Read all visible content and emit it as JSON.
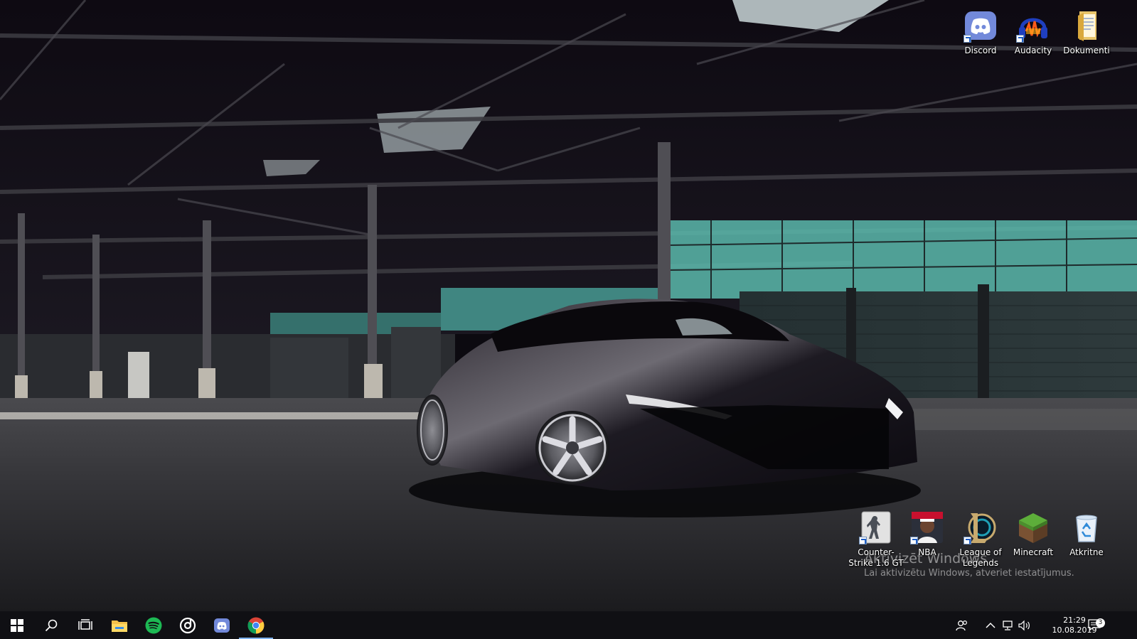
{
  "desktop": {
    "top_icons": [
      {
        "name": "discord",
        "label": "Discord",
        "icon": "discord-icon"
      },
      {
        "name": "audacity",
        "label": "Audacity",
        "icon": "audacity-icon"
      },
      {
        "name": "dokumenti",
        "label": "Dokumenti",
        "icon": "folder-icon"
      }
    ],
    "bottom_icons": [
      {
        "name": "counter-strike",
        "label": "Counter-Strike 1.6 GT",
        "icon": "counter-strike-icon"
      },
      {
        "name": "nba",
        "label": "NBA",
        "icon": "nba-icon"
      },
      {
        "name": "league-of-legends",
        "label": "League of Legends",
        "icon": "league-of-legends-icon"
      },
      {
        "name": "minecraft",
        "label": "Minecraft",
        "icon": "minecraft-icon"
      },
      {
        "name": "recycle-bin",
        "label": "Atkritne",
        "icon": "recycle-bin-icon"
      }
    ]
  },
  "watermark": {
    "line1": "Aktivizēt Windows",
    "line2": "Lai aktivizētu Windows, atveriet iestatījumus."
  },
  "taskbar": {
    "pinned": [
      {
        "name": "start",
        "icon": "windows-logo-icon"
      },
      {
        "name": "search",
        "icon": "search-icon"
      },
      {
        "name": "task-view",
        "icon": "task-view-icon"
      },
      {
        "name": "file-explorer",
        "icon": "file-explorer-icon"
      },
      {
        "name": "spotify",
        "icon": "spotify-icon"
      },
      {
        "name": "groove",
        "icon": "groove-music-icon"
      },
      {
        "name": "discord",
        "icon": "discord-icon"
      },
      {
        "name": "chrome",
        "icon": "chrome-icon",
        "active": true
      }
    ],
    "tray": {
      "icons": [
        "people-icon",
        "chevron-up-icon",
        "network-icon",
        "volume-icon"
      ],
      "time": "21:29",
      "date": "10.08.2019",
      "notification_count": "3"
    }
  },
  "colors": {
    "taskbar_bg": "#101014",
    "active_indicator": "#7fb2ee",
    "discord_blurple": "#7289da",
    "spotify_green": "#1db954"
  }
}
